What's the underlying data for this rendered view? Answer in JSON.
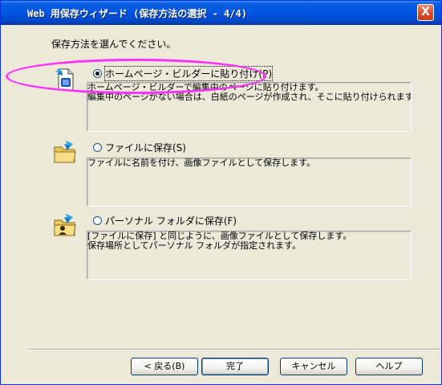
{
  "window": {
    "title": "Web 用保存ウィザード (保存方法の選択 - 4/4)",
    "close_label": "X"
  },
  "instruction": "保存方法を選んでください。",
  "options": [
    {
      "label": "ホームページ・ビルダーに貼り付け(P)",
      "selected": true,
      "icon": "homepage-builder-page-icon",
      "description": [
        "ホームページ・ビルダーで編集中のページに貼り付けます。",
        "編集中のページがない場合は、白紙のページが作成され、そこに貼り付けられます。"
      ]
    },
    {
      "label": "ファイルに保存(S)",
      "selected": false,
      "icon": "folder-save-icon",
      "description": [
        "ファイルに名前を付け、画像ファイルとして保存します。"
      ]
    },
    {
      "label": "パーソナル フォルダに保存(F)",
      "selected": false,
      "icon": "personal-folder-icon",
      "description": [
        "[ファイルに保存] と同じように、画像ファイルとして保存します。",
        "保存場所としてパーソナル フォルダが指定されます。"
      ]
    }
  ],
  "buttons": {
    "back": "< 戻る(B)",
    "finish": "完了",
    "cancel": "キャンセル",
    "help": "ヘルプ"
  },
  "colors": {
    "titlebar": "#0055e5",
    "dialog_bg": "#ece9d8",
    "highlight_ellipse": "#ff33ff"
  }
}
